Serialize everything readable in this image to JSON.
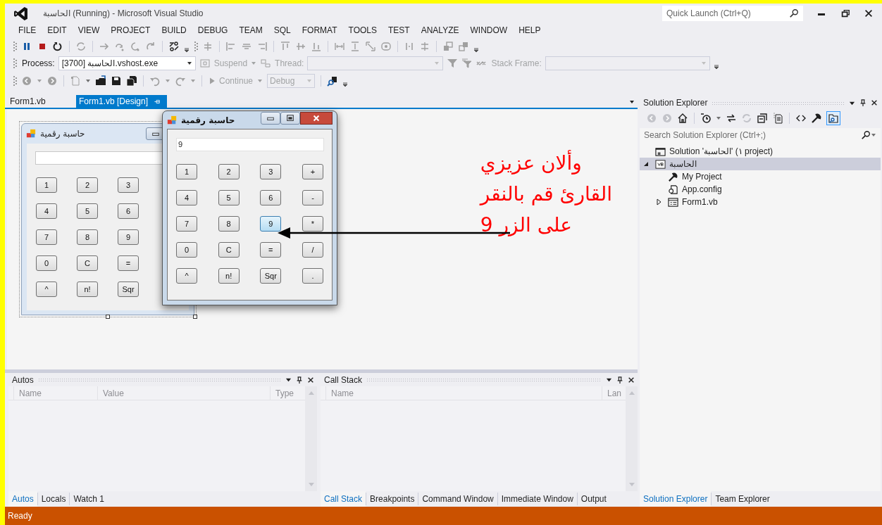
{
  "window": {
    "title": "الحاسبة (Running) - Microsoft Visual Studio",
    "quick_launch": {
      "placeholder": "Quick Launch (Ctrl+Q)"
    }
  },
  "menu": [
    "FILE",
    "EDIT",
    "VIEW",
    "PROJECT",
    "BUILD",
    "DEBUG",
    "TEAM",
    "SQL",
    "FORMAT",
    "TOOLS",
    "TEST",
    "ANALYZE",
    "WINDOW",
    "HELP"
  ],
  "debug_location": {
    "process_label": "Process:",
    "process": "[3700] الحاسبة.vshost.exe",
    "suspend": "Suspend",
    "thread_label": "Thread:",
    "stack_frame_label": "Stack Frame:"
  },
  "standard_toolbar": {
    "continue": "Continue",
    "configuration": "Debug"
  },
  "document_tabs": [
    {
      "label": "Form1.vb",
      "selected": false
    },
    {
      "label": "Form1.vb [Design]",
      "selected": true
    }
  ],
  "designer_form": {
    "title": "حاسبة رقمية",
    "buttons": [
      "1",
      "2",
      "3",
      "4",
      "5",
      "6",
      "7",
      "8",
      "9",
      "0",
      "C",
      "=",
      "^",
      "n!",
      "Sqr"
    ]
  },
  "running_form": {
    "title": "حاسبة رقمية",
    "display": "9",
    "buttons": [
      {
        "label": "1",
        "hot": false
      },
      {
        "label": "2",
        "hot": false
      },
      {
        "label": "3",
        "hot": false
      },
      {
        "label": "+",
        "hot": false
      },
      {
        "label": "4",
        "hot": false
      },
      {
        "label": "5",
        "hot": false
      },
      {
        "label": "6",
        "hot": false
      },
      {
        "label": "-",
        "hot": false
      },
      {
        "label": "7",
        "hot": false
      },
      {
        "label": "8",
        "hot": false
      },
      {
        "label": "9",
        "hot": true
      },
      {
        "label": "*",
        "hot": false
      },
      {
        "label": "0",
        "hot": false
      },
      {
        "label": "C",
        "hot": false
      },
      {
        "label": "=",
        "hot": false
      },
      {
        "label": "/",
        "hot": false
      },
      {
        "label": "^",
        "hot": false
      },
      {
        "label": "n!",
        "hot": false
      },
      {
        "label": "Sqr",
        "hot": false
      },
      {
        "label": ".",
        "hot": false
      }
    ]
  },
  "annotation": [
    "وألان عزيزي",
    "القارئ قم بالنقر",
    "على الزر 9"
  ],
  "solution_explorer": {
    "title": "Solution Explorer",
    "search": {
      "placeholder": "Search Solution Explorer (Ctrl+;)"
    },
    "tree": [
      {
        "kind": "solution",
        "label": "Solution 'الحاسبة' (١ project)",
        "selected": false
      },
      {
        "kind": "project",
        "label": "الحاسبة",
        "selected": true,
        "expanded": true,
        "children": [
          {
            "kind": "properties",
            "label": "My Project",
            "selected": false
          },
          {
            "kind": "config",
            "label": "App.config",
            "selected": false
          },
          {
            "kind": "form",
            "label": "Form1.vb",
            "selected": false,
            "expanded": false
          }
        ]
      }
    ]
  },
  "autos": {
    "title": "Autos",
    "columns": [
      "Name",
      "Value",
      "Type"
    ]
  },
  "call_stack": {
    "title": "Call Stack",
    "columns": [
      "Name",
      "Lan"
    ]
  },
  "bottom_tabs_left": [
    {
      "label": "Autos",
      "selected": true
    },
    {
      "label": "Locals",
      "selected": false
    },
    {
      "label": "Watch 1",
      "selected": false
    }
  ],
  "bottom_tabs_middle": [
    {
      "label": "Call Stack",
      "selected": true
    },
    {
      "label": "Breakpoints",
      "selected": false
    },
    {
      "label": "Command Window",
      "selected": false
    },
    {
      "label": "Immediate Window",
      "selected": false
    },
    {
      "label": "Output",
      "selected": false
    }
  ],
  "bottom_tabs_right": [
    {
      "label": "Solution Explorer",
      "selected": true
    },
    {
      "label": "Team Explorer",
      "selected": false
    }
  ],
  "status_bar": {
    "text": "Ready"
  }
}
